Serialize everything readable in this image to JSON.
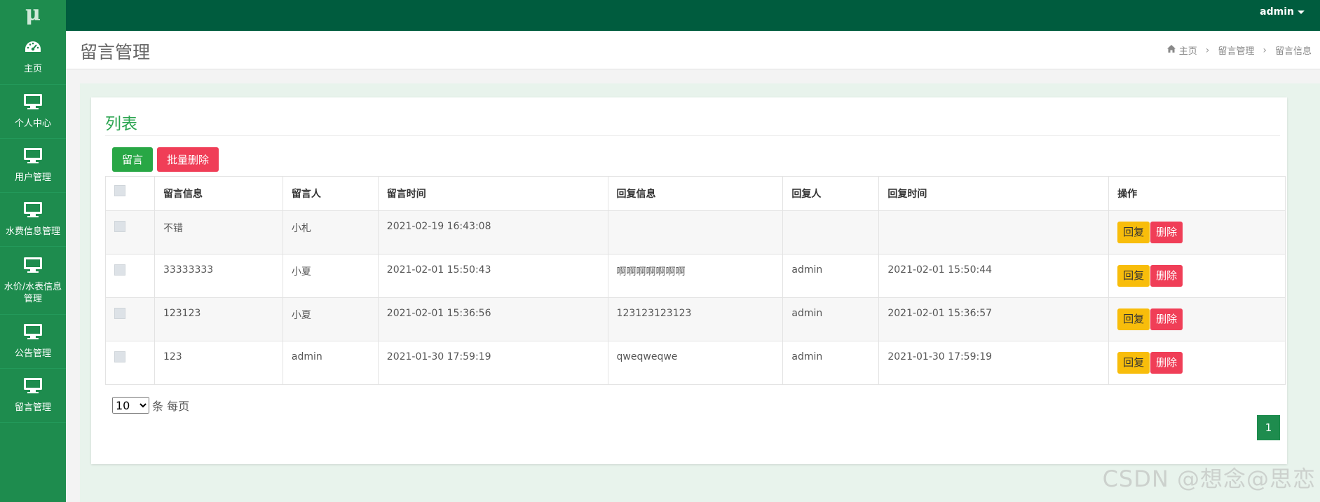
{
  "app": {
    "logo": "μ",
    "user": "admin"
  },
  "sidebar": {
    "items": [
      {
        "label": "主页",
        "icon": "dashboard-icon"
      },
      {
        "label": "个人中心",
        "icon": "monitor-icon"
      },
      {
        "label": "用户管理",
        "icon": "monitor-icon"
      },
      {
        "label": "水费信息管理",
        "icon": "monitor-icon"
      },
      {
        "label": "水价/水表信息管理",
        "icon": "monitor-icon"
      },
      {
        "label": "公告管理",
        "icon": "monitor-icon"
      },
      {
        "label": "留言管理",
        "icon": "monitor-icon"
      }
    ]
  },
  "header": {
    "title": "留言管理",
    "breadcrumb": [
      "主页",
      "留言管理",
      "留言信息"
    ]
  },
  "panel": {
    "title": "列表",
    "add_label": "留言",
    "batch_delete_label": "批量删除"
  },
  "table": {
    "columns": [
      "留言信息",
      "留言人",
      "留言时间",
      "回复信息",
      "回复人",
      "回复时间",
      "操作"
    ],
    "rows": [
      {
        "message": "不错",
        "author": "小札",
        "time": "2021-02-19 16:43:08",
        "reply": "",
        "replier": "",
        "reply_time": ""
      },
      {
        "message": "33333333",
        "author": "小夏",
        "time": "2021-02-01 15:50:43",
        "reply": "啊啊啊啊啊啊啊",
        "replier": "admin",
        "reply_time": "2021-02-01 15:50:44"
      },
      {
        "message": "123123",
        "author": "小夏",
        "time": "2021-02-01 15:36:56",
        "reply": "123123123123",
        "replier": "admin",
        "reply_time": "2021-02-01 15:36:57"
      },
      {
        "message": "123",
        "author": "admin",
        "time": "2021-01-30 17:59:19",
        "reply": "qweqweqwe",
        "replier": "admin",
        "reply_time": "2021-01-30 17:59:19"
      }
    ],
    "reply_label": "回复",
    "delete_label": "删除"
  },
  "pagination": {
    "page_size": "10",
    "page_size_options": [
      "10"
    ],
    "per_page_label": "条 每页",
    "current_page": "1"
  },
  "watermark": "CSDN @想念@思恋",
  "colors": {
    "topbar": "#005c3e",
    "sidebar": "#1e8c4e",
    "accent": "#28a745",
    "danger": "#f03e57",
    "warning": "#f8bd0b"
  }
}
